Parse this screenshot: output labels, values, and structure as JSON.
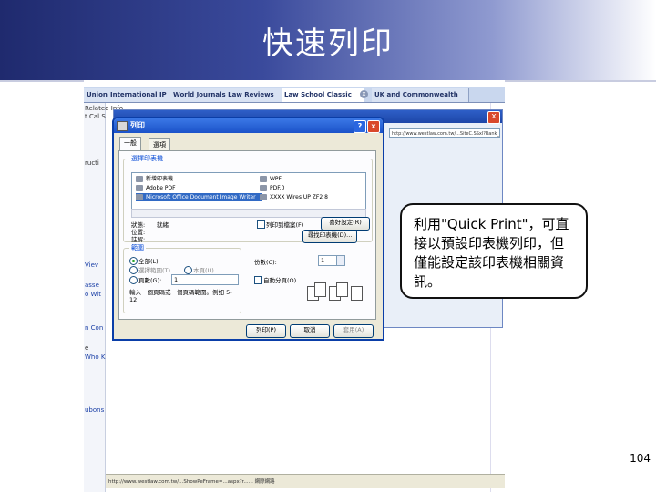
{
  "slide": {
    "title": "快速列印",
    "callout": "利用\"Quick Print\"，可直接以預設印表機列印，但僅能設定該印表機相關資訊。",
    "page_number": "104"
  },
  "browser": {
    "tabs": [
      "Union",
      "International IP",
      "World Journals Law Reviews",
      "Law School Classic",
      "UK and Commonwealth"
    ],
    "tab_close": "x",
    "left_strip_texts": [
      "Related Info",
      "t Cal S",
      "ructi",
      "Viev",
      "asse",
      "o Wit",
      "n Con",
      "e",
      "Who K",
      "ubons"
    ],
    "url_text": "http://www.westlaw.com.tw/...SiteC.SSxl?Rank_ng&Mt=..."
  },
  "dialog": {
    "title": "列印",
    "help_button": "?",
    "close_button": "x",
    "tabs": [
      "一般",
      "選項"
    ],
    "select_printer_label": "選擇印表機",
    "printers": [
      "新增印表機",
      "Adobe PDF",
      "Microsoft Office Document Image Writer",
      "WPF",
      "PDF.0",
      "XXXX Wires UP ZF2 8"
    ],
    "status_label": "狀態:",
    "status_value": "就緒",
    "location_label": "位置:",
    "comment_label": "註解:",
    "print_to_file_label": "列印到檔案(F)",
    "preferences_button": "喜好設定(R)",
    "find_printer_button": "尋找印表機(D)...",
    "page_range_label": "範圍",
    "all_label": "全部(L)",
    "selection_label": "選擇範圍(T)",
    "current_page_label": "本頁(U)",
    "pages_label": "頁數(G):",
    "pages_value": "1",
    "page_hint": "輸入一個頁碼或一個頁碼範圍。例如 5-12",
    "copies_label": "份數(C):",
    "copies_value": "1",
    "collate_label": "自動分頁(O)",
    "print_button": "列印(P)",
    "cancel_button": "取消",
    "apply_button": "套用(A)"
  },
  "statusbar": {
    "text": "http://www.westlaw.com.tw/...ShowPeFrame=...aspx?r...... 網際網路"
  }
}
